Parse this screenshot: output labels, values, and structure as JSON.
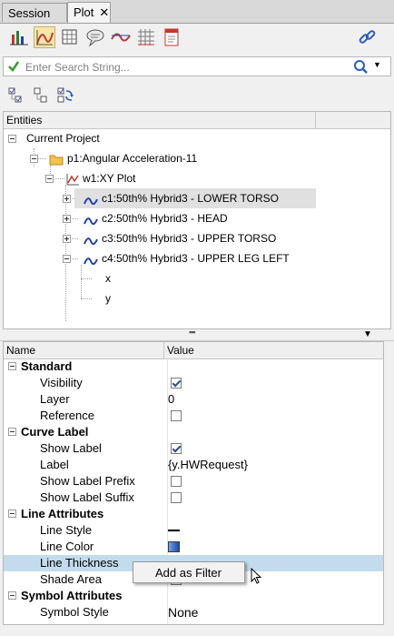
{
  "tabs": [
    {
      "label": "Session"
    },
    {
      "label": "Plot",
      "close": "✕"
    }
  ],
  "search": {
    "placeholder": "Enter Search String..."
  },
  "entities": {
    "header": "Entities",
    "tree": [
      {
        "label": "Current Project"
      },
      {
        "label": "p1:Angular Acceleration-11"
      },
      {
        "label": "w1:XY Plot"
      },
      {
        "label": "c1:50th% Hybrid3  - LOWER TORSO"
      },
      {
        "label": "c2:50th% Hybrid3  - HEAD"
      },
      {
        "label": "c3:50th% Hybrid3  - UPPER TORSO"
      },
      {
        "label": "c4:50th% Hybrid3  - UPPER LEG LEFT"
      },
      {
        "label": "x"
      },
      {
        "label": "y"
      }
    ]
  },
  "properties": {
    "col_name": "Name",
    "col_value": "Value",
    "groups": [
      {
        "label": "Standard",
        "rows": [
          {
            "name": "Visibility",
            "checkbox": true
          },
          {
            "name": "Layer",
            "value": "0"
          },
          {
            "name": "Reference",
            "checkbox": false
          }
        ]
      },
      {
        "label": "Curve Label",
        "rows": [
          {
            "name": "Show Label",
            "checkbox": true
          },
          {
            "name": "Label",
            "value": "{y.HWRequest}"
          },
          {
            "name": "Show Label Prefix",
            "checkbox": false
          },
          {
            "name": "Show Label Suffix",
            "checkbox": false
          }
        ]
      },
      {
        "label": "Line Attributes",
        "rows": [
          {
            "name": "Line Style"
          },
          {
            "name": "Line Color"
          },
          {
            "name": "Line Thickness"
          },
          {
            "name": "Shade Area"
          }
        ]
      },
      {
        "label": "Symbol Attributes",
        "rows": [
          {
            "name": "Symbol Style",
            "value": "None"
          }
        ]
      }
    ]
  },
  "context_menu": {
    "item": "Add as Filter"
  },
  "colors": {
    "curve_blue": "#1f3fb0",
    "line_color_swatch": "#2a5cc0",
    "highlight_row": "#c3dced",
    "selected_tool": "#f6e6a8"
  },
  "icons": [
    "session-tab",
    "chart-icon",
    "curve-icon",
    "grid-icon",
    "note-icon",
    "datum-icon",
    "table-icon",
    "report-icon",
    "link-icon",
    "checkmark-icon",
    "search-icon",
    "expand-all-icon",
    "collapse-all-icon",
    "sync-icon",
    "folder-icon",
    "xy-plot-icon",
    "curve-line-icon",
    "mouse-cursor-icon"
  ]
}
